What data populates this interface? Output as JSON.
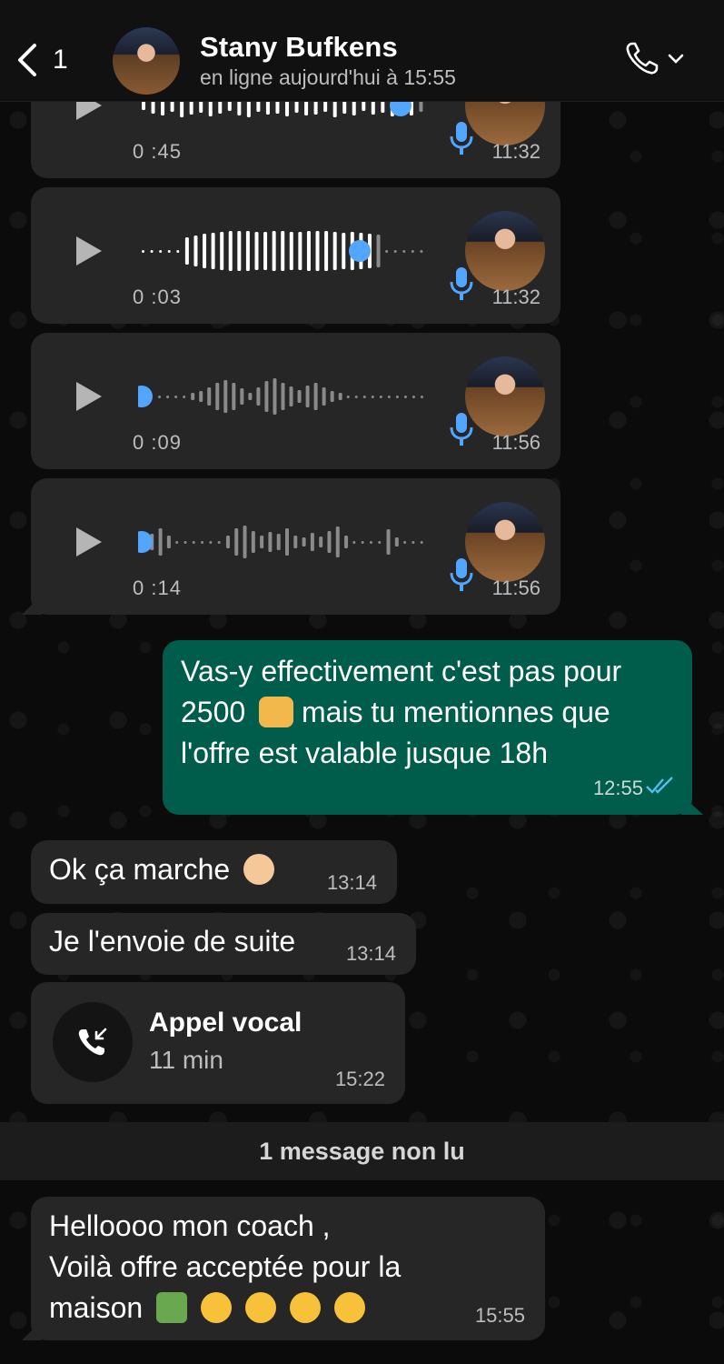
{
  "header": {
    "back_count": "1",
    "contact_name": "Stany Bufkens",
    "status": "en ligne aujourd'hui à 15:55"
  },
  "voice_messages": [
    {
      "duration": "0 :45",
      "time": "11:32",
      "progress": 0.95
    },
    {
      "duration": "0 :03",
      "time": "11:32",
      "progress": 0.8
    },
    {
      "duration": "0 :09",
      "time": "11:56",
      "progress": 0.0
    },
    {
      "duration": "0 :14",
      "time": "11:56",
      "progress": 0.0
    }
  ],
  "outgoing": {
    "line1": "Vas-y effectivement c'est pas pour",
    "line2_a": "2500",
    "line2_b": "mais tu mentionnes que",
    "line3": "l'offre est valable jusque 18h",
    "time": "12:55"
  },
  "incoming": [
    {
      "text": "Ok ça marche",
      "time": "13:14"
    },
    {
      "text": "Je l'envoie de suite",
      "time": "13:14"
    }
  ],
  "call": {
    "title": "Appel vocal",
    "duration": "11 min",
    "time": "15:22"
  },
  "unread_separator": "1 message non lu",
  "last_message": {
    "line1": "Helloooo mon coach ,",
    "line2": "Voilà offre acceptée pour la",
    "line3": "maison",
    "time": "15:55"
  },
  "colors": {
    "accent_blue": "#53a6ff",
    "outgoing_bubble": "#005c4b",
    "incoming_bubble": "#262626"
  }
}
